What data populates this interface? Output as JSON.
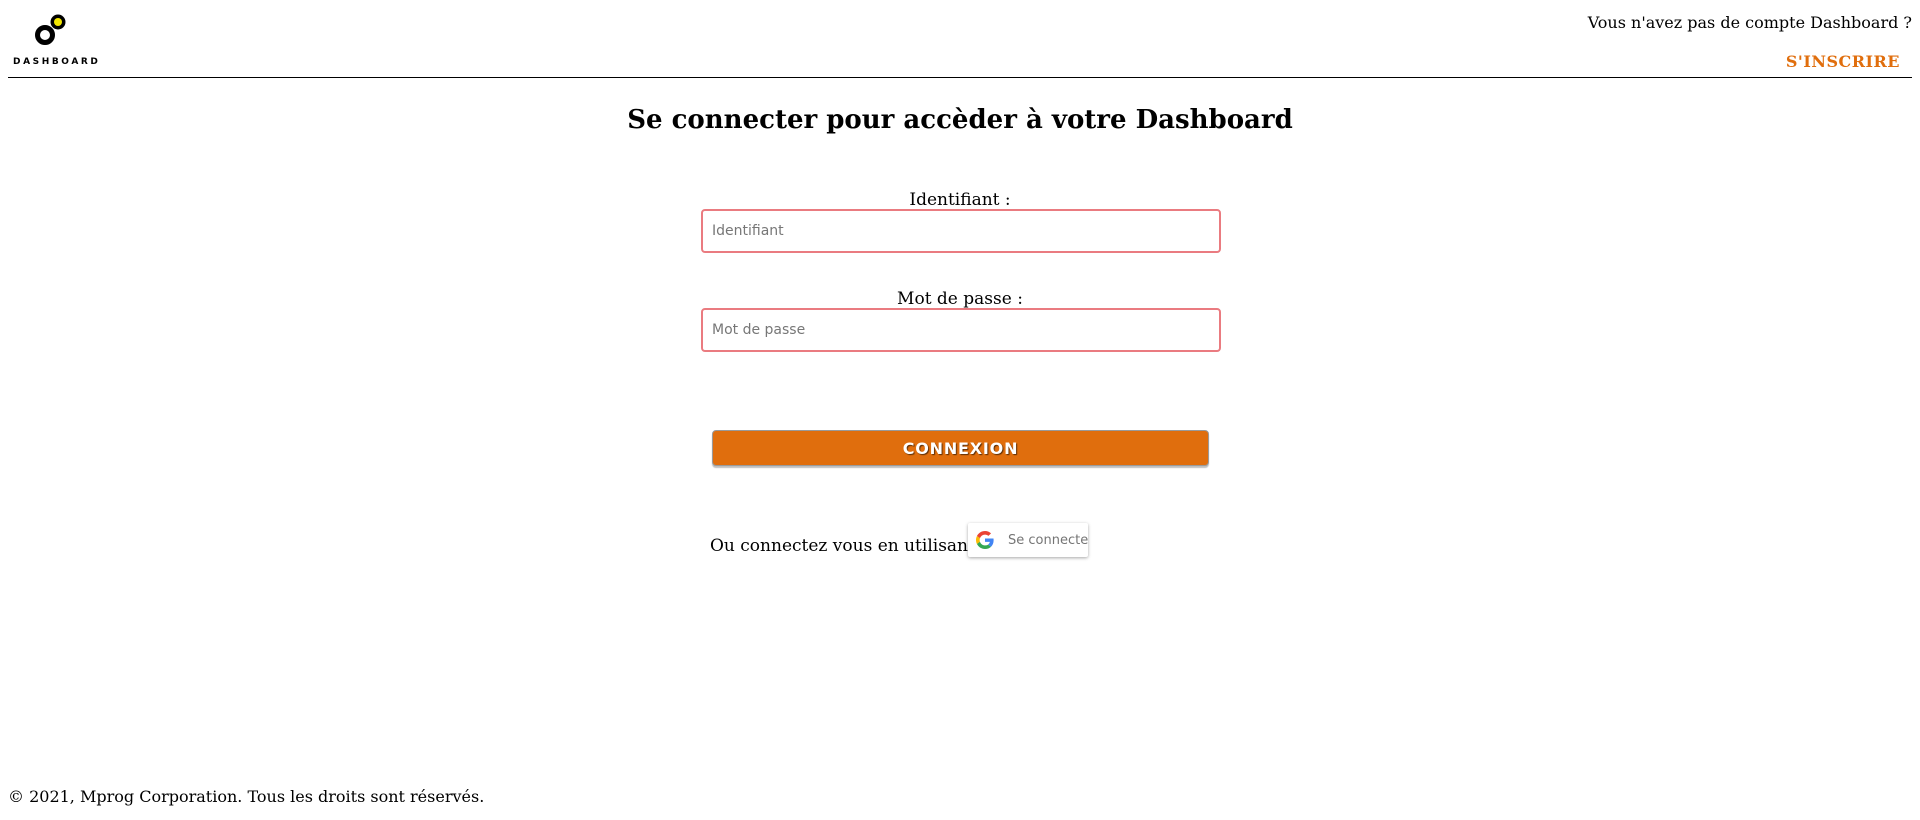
{
  "header": {
    "logo_text": "DASHBOARD",
    "no_account_text": "Vous n'avez pas de compte Dashboard ?",
    "signup_label": "S'INSCRIRE"
  },
  "main": {
    "title": "Se connecter pour accèder à votre Dashboard",
    "username": {
      "label": "Identifiant :",
      "placeholder": "Identifiant",
      "value": ""
    },
    "password": {
      "label": "Mot de passe :",
      "placeholder": "Mot de passe",
      "value": ""
    },
    "submit_label": "CONNEXION",
    "alt_login_text": "Ou connectez vous en utilisant",
    "google_button_label": "Se connecter"
  },
  "footer": {
    "copyright": "© 2021, Mprog Corporation. Tous les droits sont réservés."
  },
  "colors": {
    "accent": "#e06e0d",
    "input_border": "#ea7b80",
    "logo_dot": "#f2e600"
  },
  "icons": {
    "logo": "dashboard-logo-icon",
    "google": "google-g-icon"
  }
}
